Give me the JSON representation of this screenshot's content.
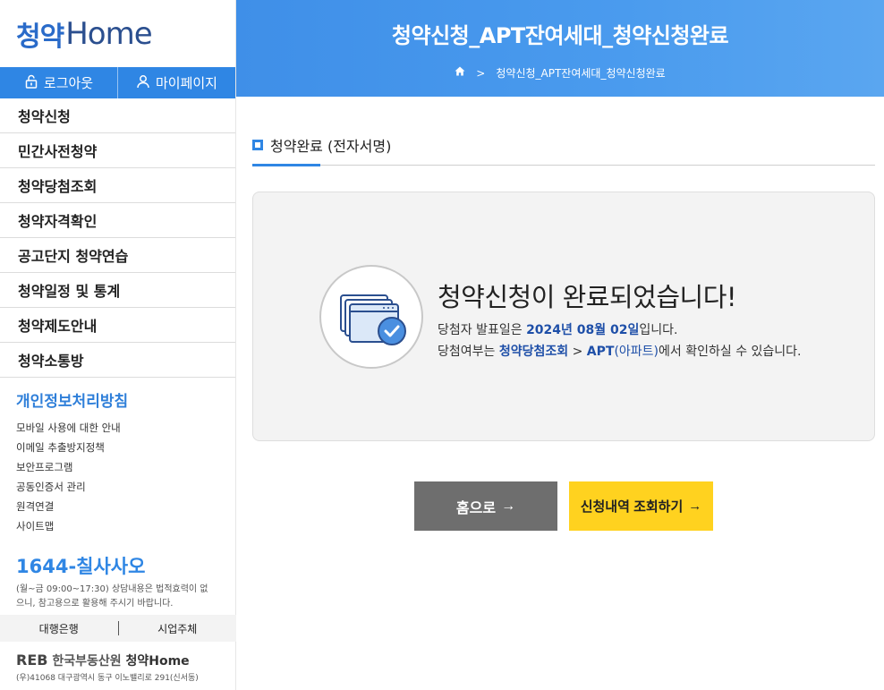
{
  "logo": {
    "mark": "청약",
    "text": "Home"
  },
  "auth": {
    "logout": "로그아웃",
    "mypage": "마이페이지"
  },
  "menu": [
    {
      "label": "청약신청"
    },
    {
      "label": "민간사전청약"
    },
    {
      "label": "청약당첨조회"
    },
    {
      "label": "청약자격확인"
    },
    {
      "label": "공고단지 청약연습"
    },
    {
      "label": "청약일정 및 통계"
    },
    {
      "label": "청약제도안내"
    },
    {
      "label": "청약소통방"
    }
  ],
  "privacy": {
    "title": "개인정보처리방침",
    "links": [
      {
        "label": "모바일 사용에 대한 안내"
      },
      {
        "label": "이메일 추출방지정책"
      },
      {
        "label": "보안프로그램"
      },
      {
        "label": "공동인증서 관리"
      },
      {
        "label": "원격연결"
      },
      {
        "label": "사이트맵"
      }
    ]
  },
  "contact": {
    "phone": "1644-칠사사오",
    "note": "(월~금 09:00~17:30) 상담내용은 법적효력이 없으니, 참고용으로 활용해 주시기 바랍니다."
  },
  "partners": {
    "bank": "대행은행",
    "operator": "시업주체"
  },
  "footer": {
    "org_reb": "REB",
    "org_name": "한국부동산원",
    "org_home": "청약Home",
    "address": "(우)41068 대구광역시 동구 이노밸리로 291(신서동)"
  },
  "header": {
    "title": "청약신청_APT잔여세대_청약신청완료",
    "breadcrumb": "청약신청_APT잔여세대_청약신청완료"
  },
  "section": {
    "label": "청약완료 (전자서명)"
  },
  "result": {
    "title": "청약신청이 완료되었습니다!",
    "line1_prefix": "당첨자 발표일은 ",
    "line1_date": "2024년 08월 02일",
    "line1_suffix": "입니다.",
    "line2_prefix": "당첨여부는 ",
    "line2_menu": "청약당첨조회",
    "line2_sep": " > ",
    "line2_target": "APT",
    "line2_target_sub": "(아파트)",
    "line2_suffix": "에서 확인하실 수 있습니다."
  },
  "buttons": {
    "home": "홈으로",
    "history": "신청내역 조회하기"
  },
  "colors": {
    "primary_blue": "#2f86e4",
    "highlight_navy": "#1e4fa8",
    "history_yellow": "#ffd21f",
    "home_gray": "#6e6e6e"
  }
}
